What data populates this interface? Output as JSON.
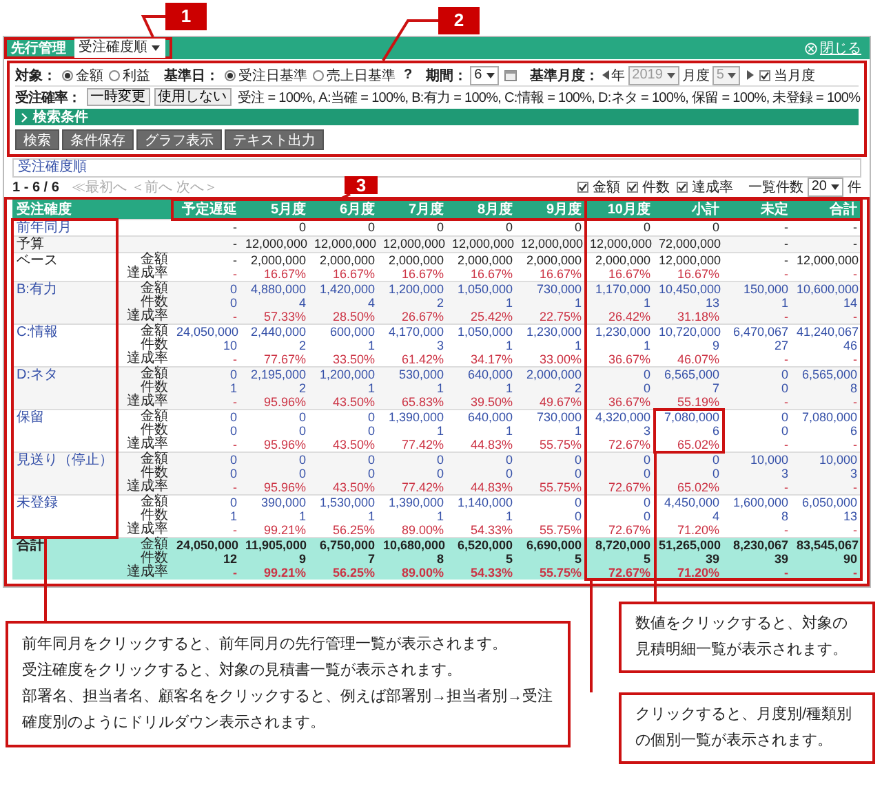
{
  "badges": [
    "1",
    "2",
    "3"
  ],
  "header": {
    "title": "先行管理",
    "view": "受注確度順",
    "close": "閉じる"
  },
  "filters": {
    "target": {
      "label": "対象：",
      "options": [
        {
          "label": "金額",
          "selected": true
        },
        {
          "label": "利益",
          "selected": false
        }
      ]
    },
    "base_date": {
      "label": "基準日：",
      "options": [
        {
          "label": "受注日基準",
          "selected": true
        },
        {
          "label": "売上日基準",
          "selected": false
        }
      ],
      "help": "?"
    },
    "period": {
      "label": "期間：",
      "value": "6"
    },
    "base_month": {
      "label": "基準月度：",
      "year_label": "年",
      "year": "2019",
      "month_label": "月度",
      "month": "5",
      "disabled": true,
      "current": {
        "label": "当月度",
        "checked": true
      }
    },
    "probability": {
      "label": "受注確率：",
      "buttons": [
        "一時変更",
        "使用しない"
      ],
      "summary": "受注 = 100%, A:当確 = 100%, B:有力 = 100%, C:情報 = 100%, D:ネタ = 100%, 保留 = 100%, 未登録 = 100%"
    }
  },
  "search_section": {
    "label": "検索条件",
    "expanded": false
  },
  "actions": [
    "検索",
    "条件保存",
    "グラフ表示",
    "テキスト出力"
  ],
  "sort_order": "受注確度順",
  "pagination": {
    "range": "1 - 6 / 6",
    "links": [
      {
        "label": "≪最初へ",
        "disabled": true
      },
      {
        "label": "＜前へ",
        "disabled": true
      },
      {
        "label": "次へ＞",
        "disabled": true
      }
    ]
  },
  "display_options": [
    {
      "label": "金額",
      "checked": true
    },
    {
      "label": "件数",
      "checked": true
    },
    {
      "label": "達成率",
      "checked": true
    }
  ],
  "page_size": {
    "label": "一覧件数",
    "value": "20",
    "unit": "件"
  },
  "table": {
    "label_column": "受注確度",
    "value_columns": [
      "予定遅延",
      "5月度",
      "6月度",
      "7月度",
      "8月度",
      "9月度",
      "10月度",
      "小計",
      "未定",
      "合計"
    ],
    "rows": [
      {
        "label": "前年同月",
        "kind": "previous",
        "lines": [
          {
            "kind": "amount",
            "values": [
              "-",
              "0",
              "0",
              "0",
              "0",
              "0",
              "0",
              "0",
              "-",
              "-"
            ]
          }
        ]
      },
      {
        "label": "予算",
        "kind": "budget",
        "lines": [
          {
            "kind": "amount",
            "values": [
              "-",
              "12,000,000",
              "12,000,000",
              "12,000,000",
              "12,000,000",
              "12,000,000",
              "12,000,000",
              "72,000,000",
              "-",
              "-"
            ]
          }
        ]
      },
      {
        "label": "ベース",
        "kind": "base",
        "lines": [
          {
            "label": "金額",
            "kind": "amount",
            "values": [
              "-",
              "2,000,000",
              "2,000,000",
              "2,000,000",
              "2,000,000",
              "2,000,000",
              "2,000,000",
              "12,000,000",
              "-",
              "12,000,000"
            ]
          },
          {
            "label": "達成率",
            "kind": "rate",
            "values": [
              "-",
              "16.67%",
              "16.67%",
              "16.67%",
              "16.67%",
              "16.67%",
              "16.67%",
              "16.67%",
              "-",
              "-"
            ]
          }
        ]
      },
      {
        "label": "B:有力",
        "kind": "group",
        "lines": [
          {
            "label": "金額",
            "kind": "amount",
            "values": [
              "0",
              "4,880,000",
              "1,420,000",
              "1,200,000",
              "1,050,000",
              "730,000",
              "1,170,000",
              "10,450,000",
              "150,000",
              "10,600,000"
            ]
          },
          {
            "label": "件数",
            "kind": "count",
            "values": [
              "0",
              "4",
              "4",
              "2",
              "1",
              "1",
              "1",
              "13",
              "1",
              "14"
            ]
          },
          {
            "label": "達成率",
            "kind": "rate",
            "values": [
              "-",
              "57.33%",
              "28.50%",
              "26.67%",
              "25.42%",
              "22.75%",
              "26.42%",
              "31.18%",
              "-",
              "-"
            ]
          }
        ]
      },
      {
        "label": "C:情報",
        "kind": "group",
        "lines": [
          {
            "label": "金額",
            "kind": "amount",
            "values": [
              "24,050,000",
              "2,440,000",
              "600,000",
              "4,170,000",
              "1,050,000",
              "1,230,000",
              "1,230,000",
              "10,720,000",
              "6,470,067",
              "41,240,067"
            ]
          },
          {
            "label": "件数",
            "kind": "count",
            "values": [
              "10",
              "2",
              "1",
              "3",
              "1",
              "1",
              "1",
              "9",
              "27",
              "46"
            ]
          },
          {
            "label": "達成率",
            "kind": "rate",
            "values": [
              "-",
              "77.67%",
              "33.50%",
              "61.42%",
              "34.17%",
              "33.00%",
              "36.67%",
              "46.07%",
              "-",
              "-"
            ]
          }
        ]
      },
      {
        "label": "D:ネタ",
        "kind": "group",
        "lines": [
          {
            "label": "金額",
            "kind": "amount",
            "values": [
              "0",
              "2,195,000",
              "1,200,000",
              "530,000",
              "640,000",
              "2,000,000",
              "0",
              "6,565,000",
              "0",
              "6,565,000"
            ]
          },
          {
            "label": "件数",
            "kind": "count",
            "values": [
              "1",
              "2",
              "1",
              "1",
              "1",
              "2",
              "0",
              "7",
              "0",
              "8"
            ]
          },
          {
            "label": "達成率",
            "kind": "rate",
            "values": [
              "-",
              "95.96%",
              "43.50%",
              "65.83%",
              "39.50%",
              "49.67%",
              "36.67%",
              "55.19%",
              "-",
              "-"
            ]
          }
        ]
      },
      {
        "label": "保留",
        "kind": "group",
        "lines": [
          {
            "label": "金額",
            "kind": "amount",
            "values": [
              "0",
              "0",
              "0",
              "1,390,000",
              "640,000",
              "730,000",
              "4,320,000",
              "7,080,000",
              "0",
              "7,080,000"
            ]
          },
          {
            "label": "件数",
            "kind": "count",
            "values": [
              "0",
              "0",
              "0",
              "1",
              "1",
              "1",
              "3",
              "6",
              "0",
              "6"
            ]
          },
          {
            "label": "達成率",
            "kind": "rate",
            "values": [
              "-",
              "95.96%",
              "43.50%",
              "77.42%",
              "44.83%",
              "55.75%",
              "72.67%",
              "65.02%",
              "-",
              "-"
            ]
          }
        ]
      },
      {
        "label": "見送り（停止）",
        "kind": "group",
        "lines": [
          {
            "label": "金額",
            "kind": "amount",
            "values": [
              "0",
              "0",
              "0",
              "0",
              "0",
              "0",
              "0",
              "0",
              "10,000",
              "10,000"
            ]
          },
          {
            "label": "件数",
            "kind": "count",
            "values": [
              "0",
              "0",
              "0",
              "0",
              "0",
              "0",
              "0",
              "0",
              "3",
              "3"
            ]
          },
          {
            "label": "達成率",
            "kind": "rate",
            "values": [
              "-",
              "95.96%",
              "43.50%",
              "77.42%",
              "44.83%",
              "55.75%",
              "72.67%",
              "65.02%",
              "-",
              "-"
            ]
          }
        ]
      },
      {
        "label": "未登録",
        "kind": "group",
        "lines": [
          {
            "label": "金額",
            "kind": "amount",
            "values": [
              "0",
              "390,000",
              "1,530,000",
              "1,390,000",
              "1,140,000",
              "0",
              "0",
              "4,450,000",
              "1,600,000",
              "6,050,000"
            ]
          },
          {
            "label": "件数",
            "kind": "count",
            "values": [
              "1",
              "1",
              "1",
              "1",
              "1",
              "0",
              "0",
              "4",
              "8",
              "13"
            ]
          },
          {
            "label": "達成率",
            "kind": "rate",
            "values": [
              "-",
              "99.21%",
              "56.25%",
              "89.00%",
              "54.33%",
              "55.75%",
              "72.67%",
              "71.20%",
              "-",
              "-"
            ]
          }
        ]
      },
      {
        "label": "合計",
        "kind": "total",
        "lines": [
          {
            "label": "金額",
            "kind": "amount",
            "values": [
              "24,050,000",
              "11,905,000",
              "6,750,000",
              "10,680,000",
              "6,520,000",
              "6,690,000",
              "8,720,000",
              "51,265,000",
              "8,230,067",
              "83,545,067"
            ]
          },
          {
            "label": "件数",
            "kind": "count",
            "values": [
              "12",
              "9",
              "7",
              "8",
              "5",
              "5",
              "5",
              "39",
              "39",
              "90"
            ]
          },
          {
            "label": "達成率",
            "kind": "rate",
            "values": [
              "-",
              "99.21%",
              "56.25%",
              "89.00%",
              "54.33%",
              "55.75%",
              "72.67%",
              "71.20%",
              "-",
              "-"
            ]
          }
        ]
      }
    ]
  },
  "callouts": {
    "left": [
      "前年同月をクリックすると、前年同月の先行管理一覧が表示されます。",
      "受注確度をクリックすると、対象の見積書一覧が表示されます。",
      "部署名、担当者名、顧客名をクリックすると、例えば部署別→担当者別→受注確度別のようにドリルダウン表示されます。"
    ],
    "right_top": "数値をクリックすると、対象の見積明細一覧が表示されます。",
    "right_bottom": "クリックすると、月度別/種類別の個別一覧が表示されます。"
  }
}
